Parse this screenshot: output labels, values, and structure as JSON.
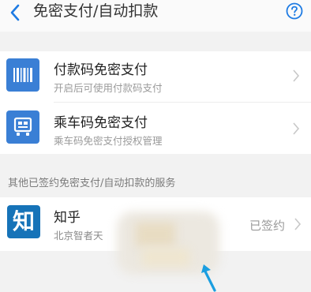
{
  "header": {
    "title": "免密支付/自动扣款",
    "back_icon": "chevron-left-icon",
    "help_icon": "question-circle-icon",
    "accent_color": "#1e7be3"
  },
  "services": [
    {
      "title": "付款码免密支付",
      "subtitle": "开启后可使用付款码支付",
      "icon": "barcode-icon",
      "icon_color": "#3a7fd5"
    },
    {
      "title": "乘车码免密支付",
      "subtitle": "乘车码免密支付授权管理",
      "icon": "bus-card-icon",
      "icon_color": "#3a7fd5"
    }
  ],
  "section": {
    "label": "其他已签约免密支付/自动扣款的服务"
  },
  "signed": [
    {
      "logo_text": "知",
      "title": "知乎",
      "subtitle": "北京智者天",
      "status": "已签约",
      "logo_color": "#1673b8"
    }
  ]
}
